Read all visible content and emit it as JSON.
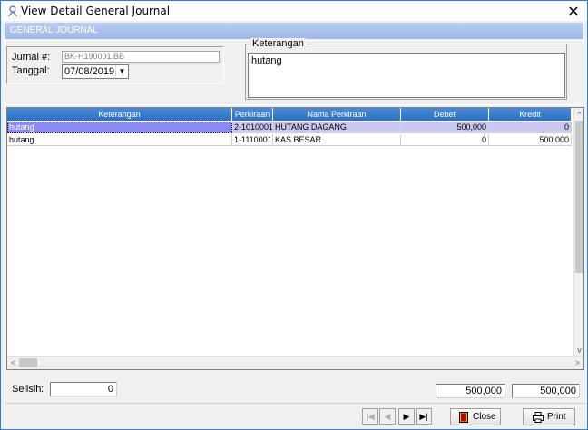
{
  "window": {
    "title": "View Detail General Journal",
    "close_glyph": "✕"
  },
  "banner": {
    "label": "GENERAL JOURNAL"
  },
  "header": {
    "jurnal_label": "Jurnal #:",
    "jurnal_value": "BK-H190001.BB",
    "tanggal_label": "Tanggal:",
    "tanggal_value": "07/08/2019",
    "dropdown_glyph": "▼",
    "keterangan_label": "Keterangan",
    "keterangan_value": "hutang"
  },
  "grid": {
    "columns": [
      "Keterangan",
      "Perkiraan",
      "Nama Perkiraan",
      "Debet",
      "Kredit"
    ],
    "rows": [
      {
        "keterangan": "hutang",
        "perkiraan": "2-1010001",
        "nama": "HUTANG DAGANG",
        "debet": "500,000",
        "kredit": "0"
      },
      {
        "keterangan": "hutang",
        "perkiraan": "1-1110001",
        "nama": "KAS BESAR",
        "debet": "0",
        "kredit": "500,000"
      }
    ],
    "scroll_up": "^",
    "scroll_down": "v",
    "scroll_left": "<",
    "scroll_right": ">"
  },
  "footer": {
    "selisih_label": "Selisih",
    "selisih_colon": ":",
    "selisih_value": "0",
    "total_debet": "500,000",
    "total_kredit": "500,000"
  },
  "nav": {
    "first": "|◀",
    "prev": "◀",
    "next": "▶",
    "last": "▶|"
  },
  "buttons": {
    "close_label": "Close",
    "print_label": "Print"
  },
  "colors": {
    "banner": "#9eb8e8",
    "grid_header": "#2c6fc8",
    "selected_row": "#c8c8f0",
    "window_border": "#2b7de9"
  },
  "icons": {
    "window": "journal-icon",
    "close": "door-icon",
    "print": "printer-icon"
  }
}
